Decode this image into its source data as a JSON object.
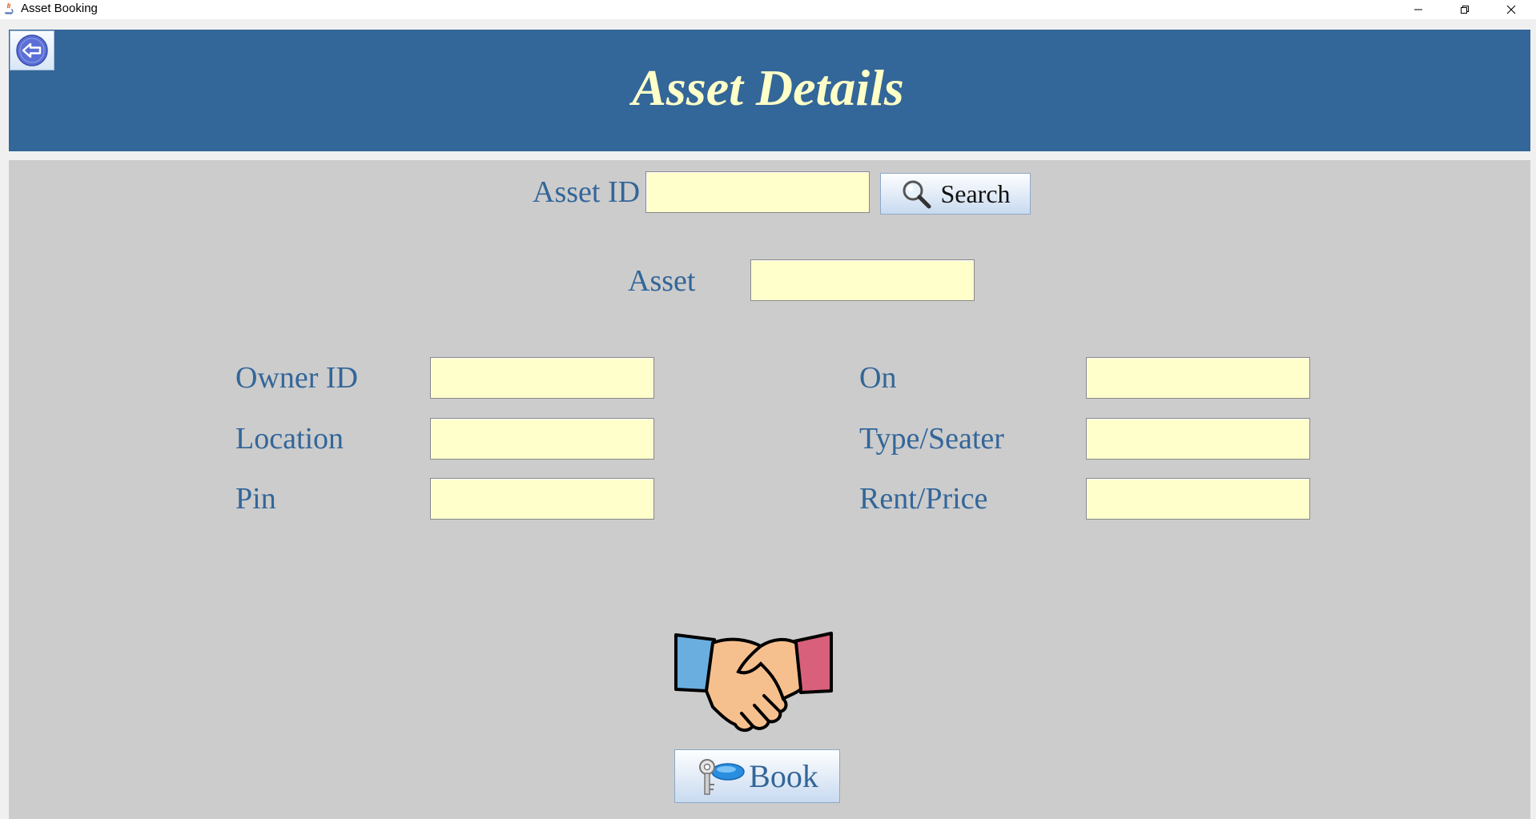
{
  "window": {
    "title": "Asset Booking",
    "controls": [
      "minimize",
      "restore",
      "close"
    ]
  },
  "header": {
    "title": "Asset Details",
    "back_icon": "back-arrow-icon",
    "bg_color": "#336699",
    "title_color": "#ffffc8"
  },
  "search": {
    "asset_id_label": "Asset ID",
    "asset_id_value": "",
    "button_label": "Search",
    "button_icon": "magnifier-icon"
  },
  "asset": {
    "label": "Asset",
    "value": ""
  },
  "left_fields": [
    {
      "label": "Owner ID",
      "value": ""
    },
    {
      "label": "Location",
      "value": ""
    },
    {
      "label": "Pin",
      "value": ""
    }
  ],
  "right_fields": [
    {
      "label": "On",
      "value": ""
    },
    {
      "label": "Type/Seater",
      "value": ""
    },
    {
      "label": "Rent/Price",
      "value": ""
    }
  ],
  "book": {
    "label": "Book",
    "icon": "key-icon",
    "illustration": "handshake-icon"
  },
  "colors": {
    "label_text": "#336699",
    "field_bg": "#ffffcc",
    "panel_bg": "#cccccc"
  }
}
